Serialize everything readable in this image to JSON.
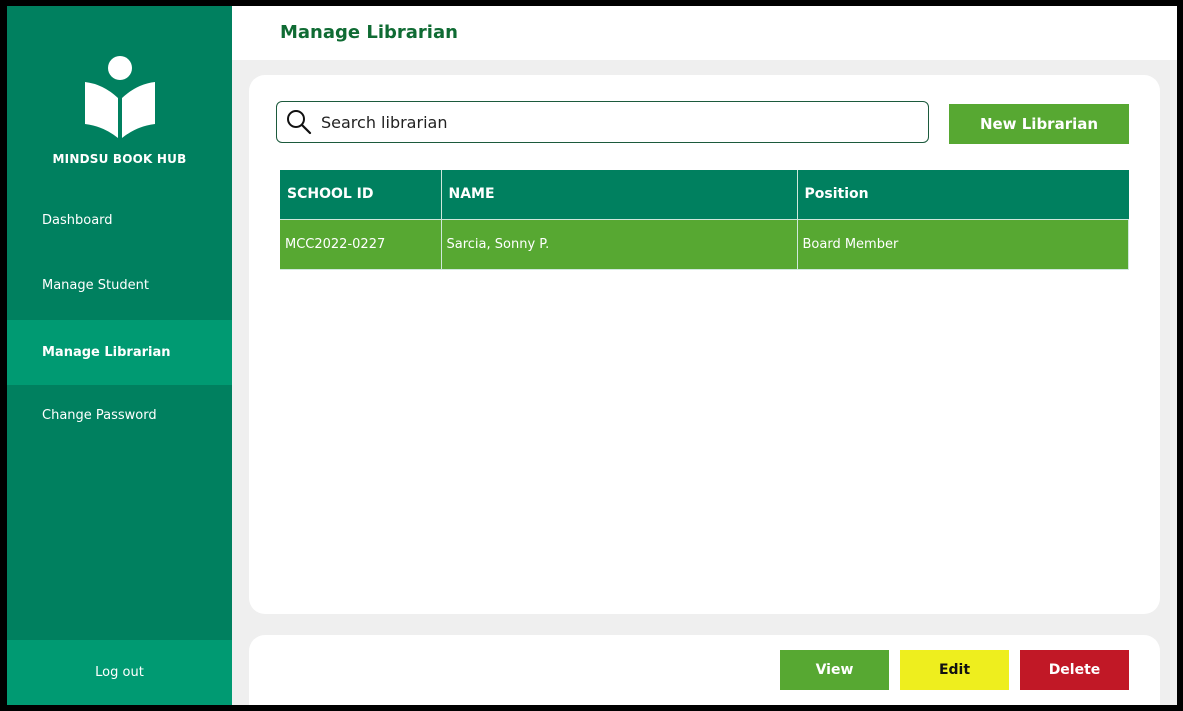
{
  "sidebar": {
    "brand": "MINDSU BOOK HUB",
    "items": [
      {
        "label": "Dashboard"
      },
      {
        "label": "Manage Student"
      },
      {
        "label": "Manage Librarian",
        "active": true
      },
      {
        "label": "Change Password"
      }
    ],
    "logout_label": "Log out"
  },
  "header": {
    "title": "Manage Librarian"
  },
  "search": {
    "placeholder": "Search librarian",
    "value": ""
  },
  "toolbar": {
    "new_label": "New Librarian"
  },
  "table": {
    "columns": [
      "SCHOOL ID",
      "NAME",
      "Position"
    ],
    "rows": [
      [
        "MCC2022-0227",
        "Sarcia, Sonny P.",
        "Board Member"
      ]
    ]
  },
  "actions": {
    "view_label": "View",
    "edit_label": "Edit",
    "delete_label": "Delete"
  },
  "colors": {
    "sidebar": "#00805f",
    "sidebar_active": "#009a72",
    "accent_green": "#57a832",
    "edit_yellow": "#eeee1e",
    "delete_red": "#c11826",
    "title_green": "#0f6b33"
  }
}
